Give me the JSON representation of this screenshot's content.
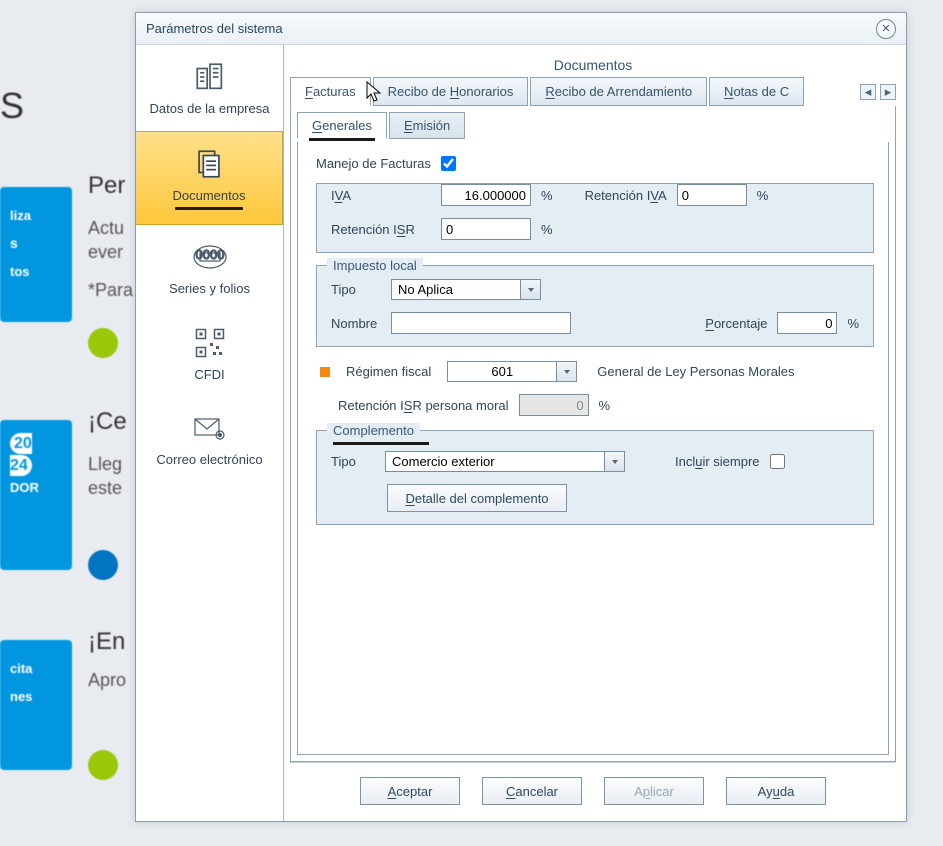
{
  "dialog": {
    "title": "Parámetros del sistema"
  },
  "sidebar": {
    "items": [
      {
        "label": "Datos de la empresa"
      },
      {
        "label": "Documentos"
      },
      {
        "label": "Series y folios"
      },
      {
        "label": "CFDI"
      },
      {
        "label": "Correo electrónico"
      }
    ]
  },
  "main": {
    "section_title": "Documentos",
    "tabs": [
      {
        "label": "Facturas"
      },
      {
        "label": "Recibo de Honorarios"
      },
      {
        "label": "Recibo de Arrendamiento"
      },
      {
        "label": "Notas de C"
      }
    ],
    "subtabs": [
      {
        "label": "Generales"
      },
      {
        "label": "Emisión"
      }
    ],
    "manejo_label": "Manejo de Facturas",
    "iva_label": "IVA",
    "iva_value": "16.000000",
    "percent": "%",
    "ret_iva_label": "Retención IVA",
    "ret_iva_value": "0",
    "ret_isr_label": "Retención ISR",
    "ret_isr_value": "0",
    "impuesto_local": {
      "title": "Impuesto local",
      "tipo_label": "Tipo",
      "tipo_value": "No Aplica",
      "nombre_label": "Nombre",
      "nombre_value": "",
      "porcentaje_label": "Porcentaje",
      "porcentaje_value": "0"
    },
    "regimen": {
      "label": "Régimen fiscal",
      "code": "601",
      "desc": "General de Ley Personas Morales",
      "ret_isr_pm_label": "Retención ISR persona moral",
      "ret_isr_pm_value": "0"
    },
    "complemento": {
      "title": "Complemento",
      "tipo_label": "Tipo",
      "tipo_value": "Comercio exterior",
      "incluir_label": "Incluir siempre",
      "detalle_btn": "Detalle del complemento"
    }
  },
  "buttons": {
    "aceptar": "Aceptar",
    "cancelar": "Cancelar",
    "aplicar": "Aplicar",
    "ayuda": "Ayuda"
  },
  "bg": {
    "s": "S",
    "per": "Per",
    "actu": "Actu",
    "ever": "ever",
    "para": "*Para",
    "ce": "¡Ce",
    "lleg": "Lleg",
    "este": "este",
    "en": "¡En",
    "apro": "Apro",
    "liza": "liza",
    "tos": "tos",
    "dor": "DOR",
    "cita": "cita",
    "nes": "nes"
  }
}
